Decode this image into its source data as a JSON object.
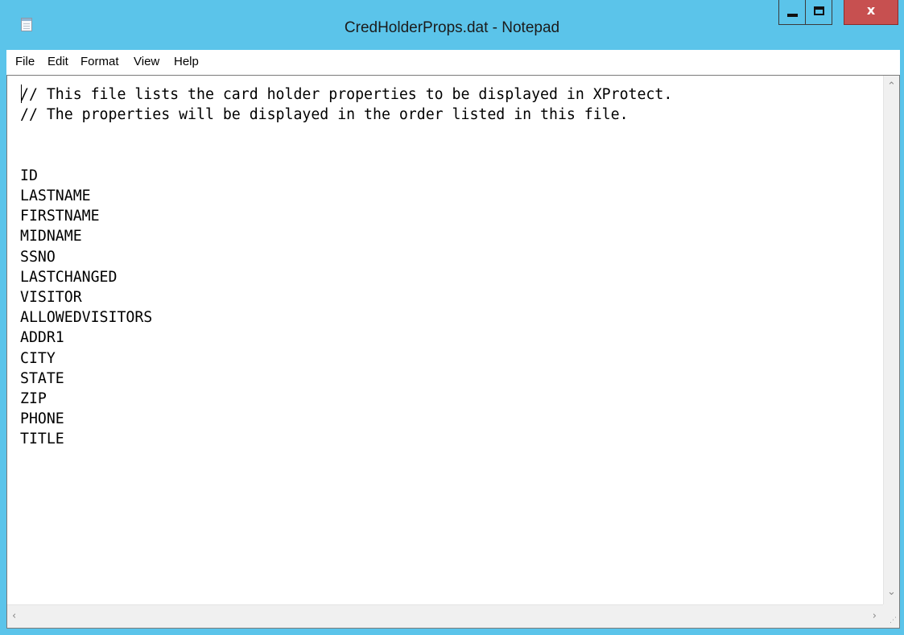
{
  "window": {
    "title": "CredHolderProps.dat - Notepad",
    "controls": {
      "minimize": "minimize",
      "maximize": "maximize",
      "close": "x"
    }
  },
  "menu": [
    {
      "label": "File"
    },
    {
      "label": "Edit"
    },
    {
      "label": "Format"
    },
    {
      "label": "View"
    },
    {
      "label": "Help"
    }
  ],
  "editor": {
    "lines": [
      "// This file lists the card holder properties to be displayed in XProtect.",
      "// The properties will be displayed in the order listed in this file.",
      "",
      "",
      "ID",
      "LASTNAME",
      "FIRSTNAME",
      "MIDNAME",
      "SSNO",
      "LASTCHANGED",
      "VISITOR",
      "ALLOWEDVISITORS",
      "ADDR1",
      "CITY",
      "STATE",
      "ZIP",
      "PHONE",
      "TITLE"
    ]
  },
  "icons": {
    "app": "notepad-document-icon",
    "scroll_up": "chevron-up-icon",
    "scroll_down": "chevron-down-icon",
    "scroll_left": "chevron-left-icon",
    "scroll_right": "chevron-right-icon",
    "size_grip": "resize-grip-icon"
  },
  "colors": {
    "titlebar": "#5bc4ea",
    "close_button": "#c75050"
  }
}
